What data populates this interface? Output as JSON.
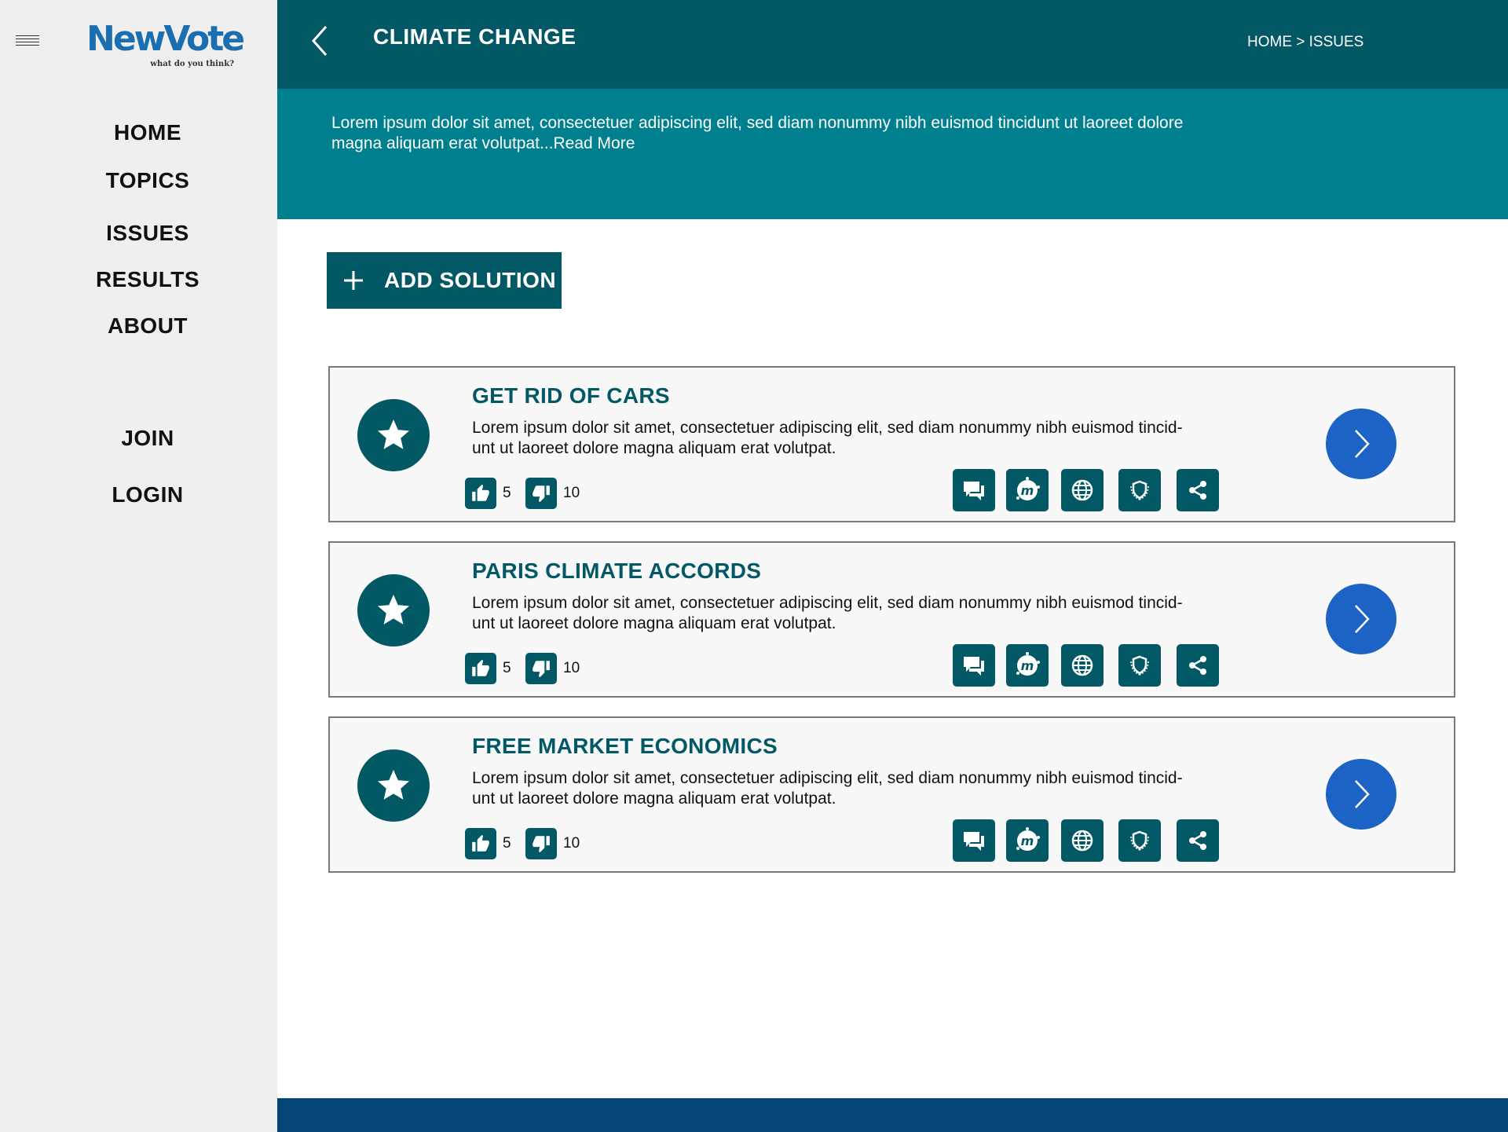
{
  "brand": {
    "name": "NewVote",
    "tagline": "what do you think?",
    "color": "#1b6fb1"
  },
  "nav": {
    "primary": [
      "HOME",
      "TOPICS",
      "ISSUES",
      "RESULTS",
      "ABOUT"
    ],
    "account": [
      "JOIN",
      "LOGIN"
    ]
  },
  "header": {
    "title": "CLIMATE CHANGE",
    "breadcrumb": {
      "home": "HOME",
      "separator": " > ",
      "current": "ISSUES"
    }
  },
  "intro": {
    "text": "Lorem ipsum dolor sit amet, consectetuer adipiscing elit, sed diam nonummy nibh euismod tincidunt ut laoreet dolore magna aliquam erat volutpat...",
    "read_more": "Read More"
  },
  "add_solution": {
    "label": "ADD SOLUTION"
  },
  "solutions": [
    {
      "title": "GET RID OF CARS",
      "description": "Lorem ipsum dolor sit amet, consectetuer adipiscing elit, sed diam nonummy nibh euismod tincid-unt ut laoreet dolore magna aliquam erat volutpat.",
      "upvotes": "5",
      "downvotes": "10"
    },
    {
      "title": "PARIS CLIMATE ACCORDS",
      "description": "Lorem ipsum dolor sit amet, consectetuer adipiscing elit, sed diam nonummy nibh euismod tincid-unt ut laoreet dolore magna aliquam erat volutpat.",
      "upvotes": "5",
      "downvotes": "10"
    },
    {
      "title": "FREE MARKET ECONOMICS",
      "description": "Lorem ipsum dolor sit amet, consectetuer adipiscing elit, sed diam nonummy nibh euismod tincid-unt ut laoreet dolore magna aliquam erat volutpat.",
      "upvotes": "5",
      "downvotes": "10"
    }
  ],
  "colors": {
    "primary": "#035865",
    "intro_bg": "#00808f",
    "accent_blue": "#1c63c5",
    "footer": "#034675",
    "sidebar_bg": "#efeff0"
  }
}
